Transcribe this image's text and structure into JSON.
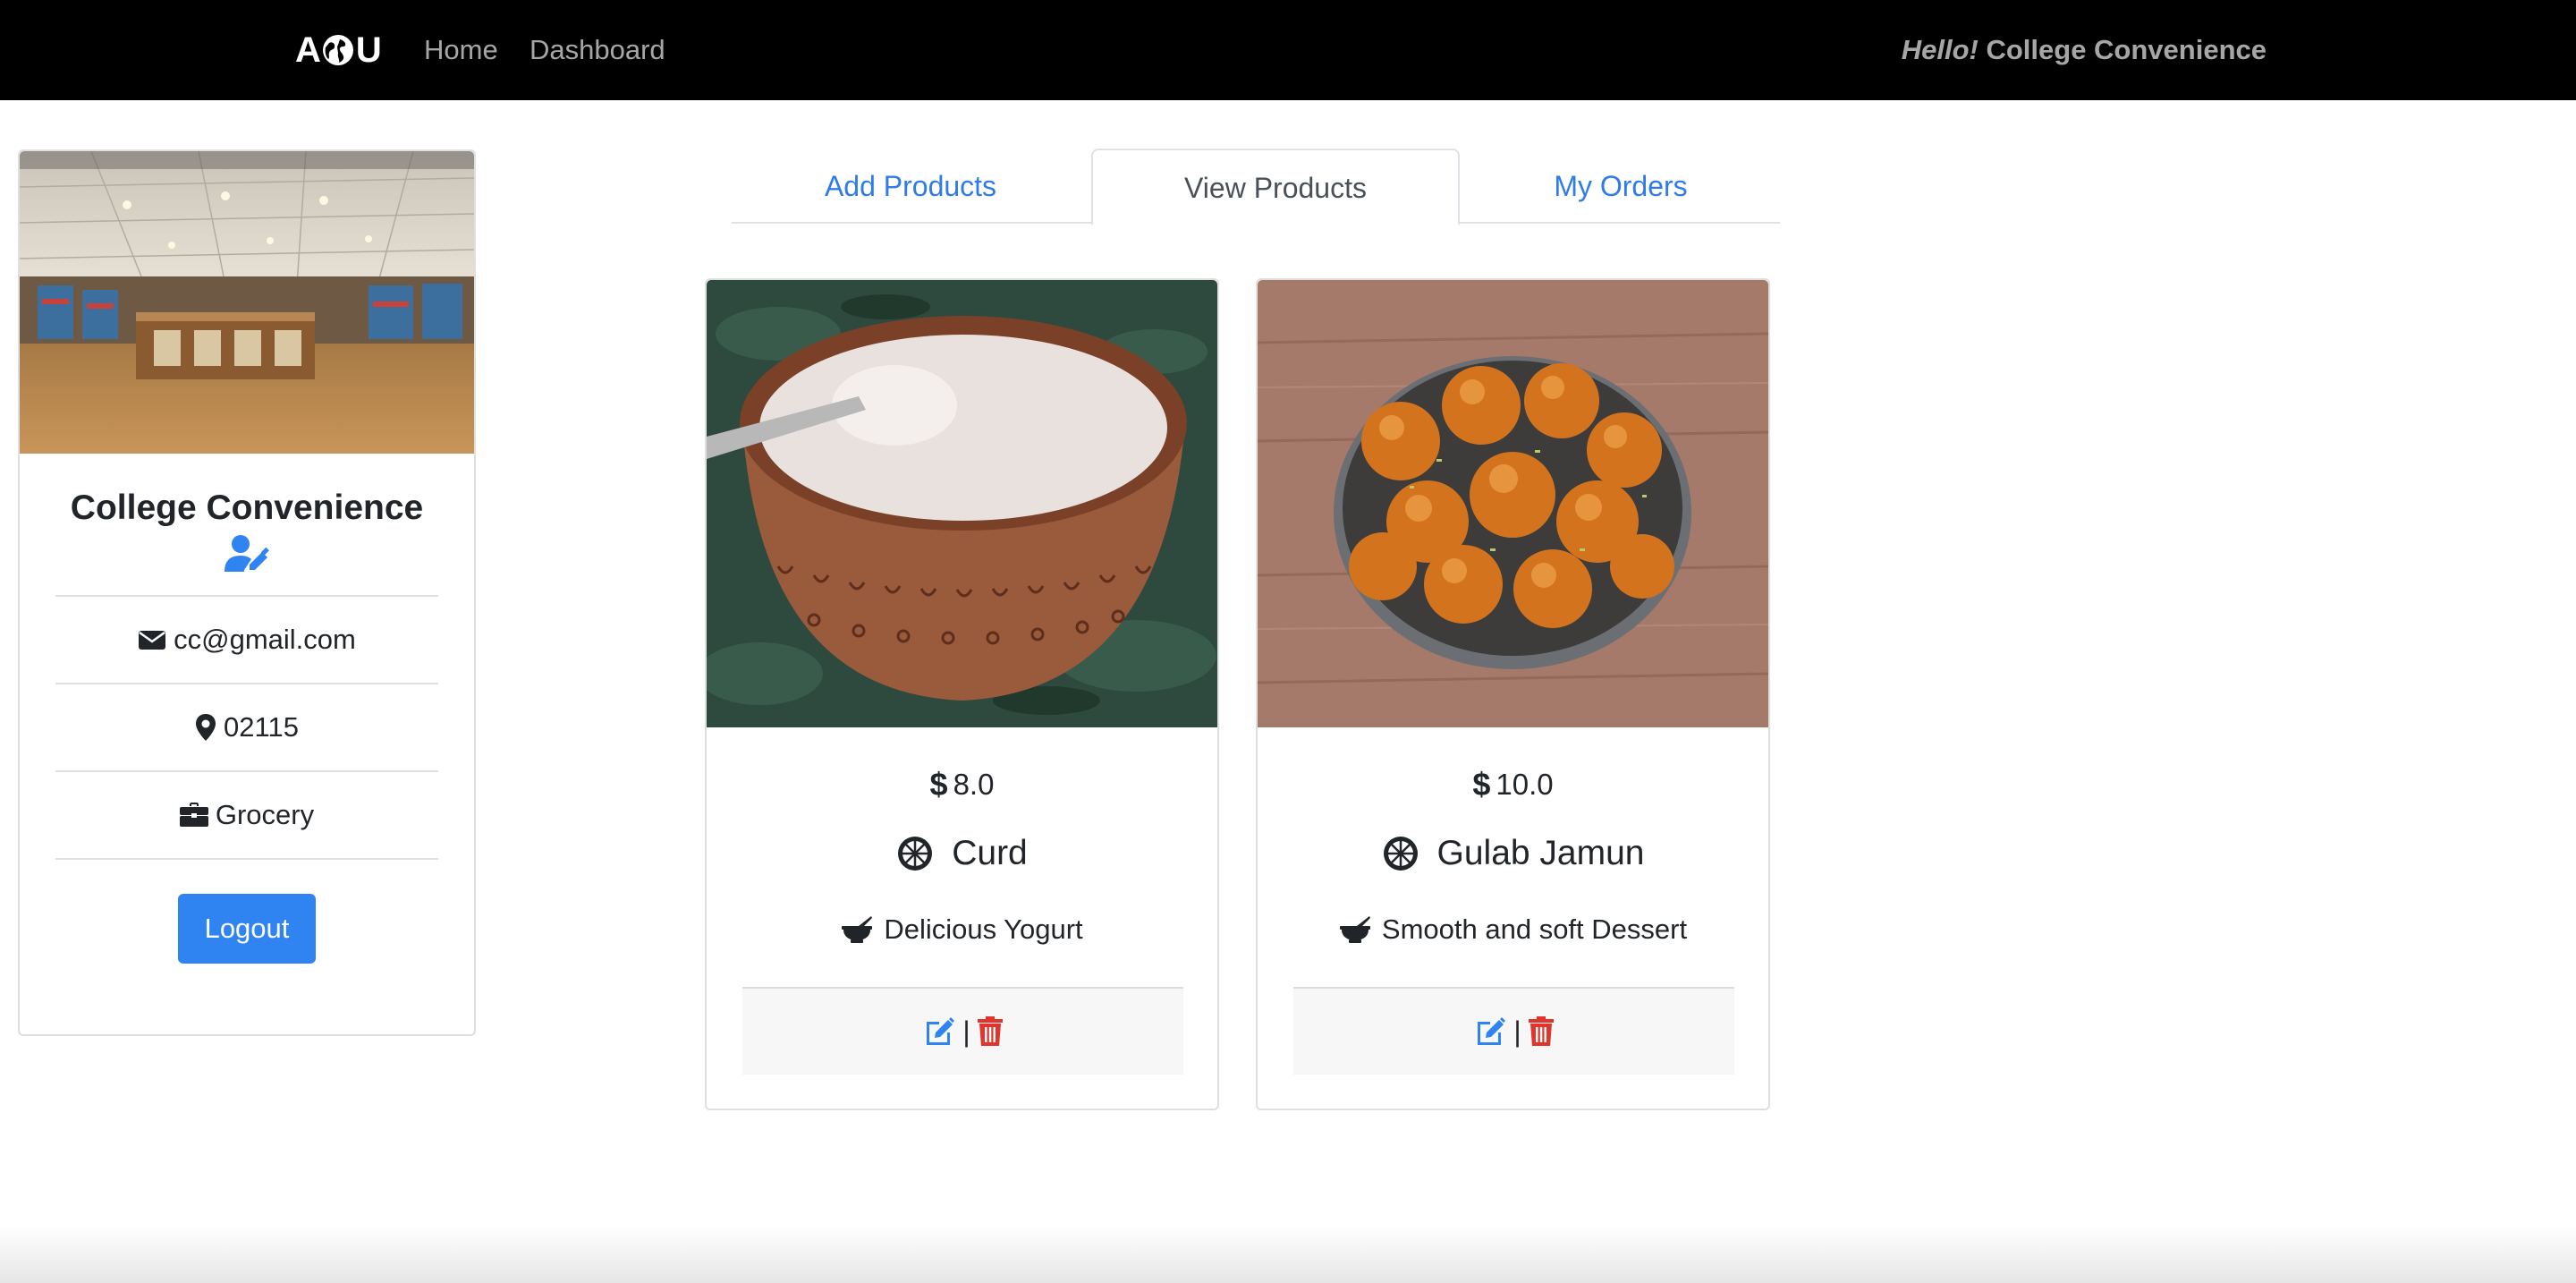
{
  "navbar": {
    "brand_left": "A",
    "brand_right": "U",
    "home": "Home",
    "dashboard": "Dashboard",
    "greeting_hello": "Hello!",
    "greeting_name": "College Convenience"
  },
  "profile": {
    "name": "College Convenience",
    "email": "cc@gmail.com",
    "zip": "02115",
    "category": "Grocery",
    "logout_label": "Logout"
  },
  "tabs": [
    {
      "label": "Add Products",
      "active": false
    },
    {
      "label": "View Products",
      "active": true
    },
    {
      "label": "My Orders",
      "active": false
    }
  ],
  "products": [
    {
      "price": "8.0",
      "name": "Curd",
      "description": "Delicious Yogurt"
    },
    {
      "price": "10.0",
      "name": "Gulab Jamun",
      "description": "Smooth and soft Dessert"
    }
  ],
  "colors": {
    "accent": "#2f84f2",
    "delete": "#e0342c",
    "navbar": "#000000"
  },
  "icons": {
    "edit_user": "user-edit-icon",
    "email": "envelope-icon",
    "zip": "map-marker-icon",
    "category": "briefcase-icon",
    "price": "dollar-icon",
    "product_name": "cookie-icon",
    "description": "mortar-pestle-icon",
    "edit": "edit-icon",
    "delete": "trash-icon"
  }
}
